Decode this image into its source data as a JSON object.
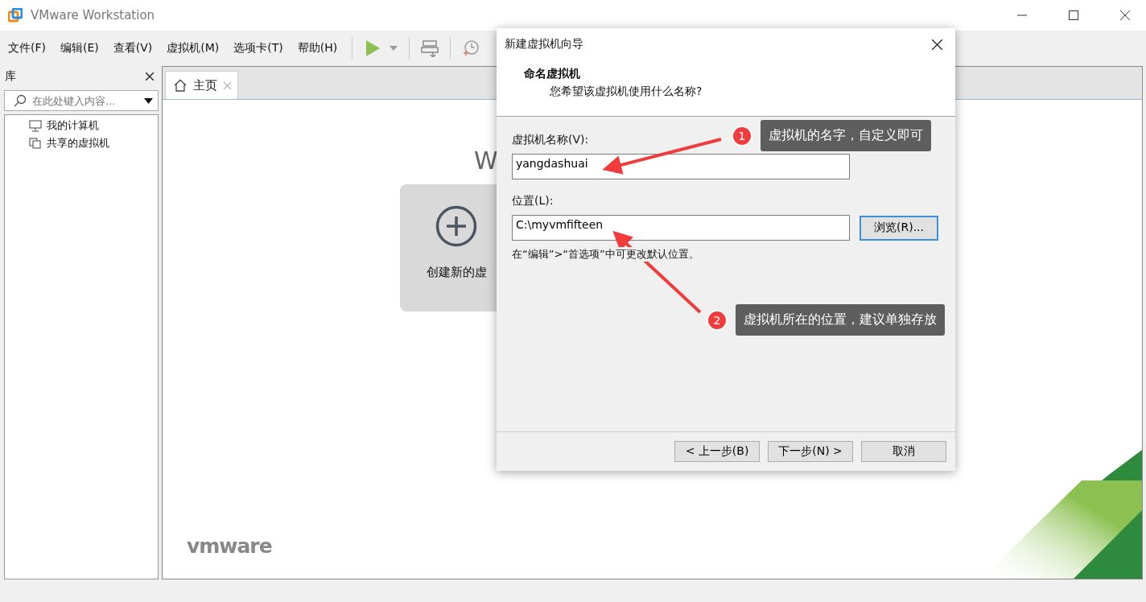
{
  "window": {
    "title": "VMware Workstation"
  },
  "menu": [
    "文件(F)",
    "编辑(E)",
    "查看(V)",
    "虚拟机(M)",
    "选项卡(T)",
    "帮助(H)"
  ],
  "library": {
    "title": "库",
    "search": {
      "placeholder": "在此处键入内容..."
    },
    "items": [
      {
        "label": "我的计算机",
        "kind": "computer"
      },
      {
        "label": "共享的虚拟机",
        "kind": "shared"
      }
    ]
  },
  "tabs": [
    {
      "label": "主页",
      "selected": true
    }
  ],
  "home": {
    "heading": "W",
    "card": "创建新的虚",
    "logo": "vmware"
  },
  "dialog": {
    "title": "新建虚拟机向导",
    "heading": "命名虚拟机",
    "subheading": "您希望该虚拟机使用什么名称?",
    "name_label": "虚拟机名称(V):",
    "name_value": "yangdashuai",
    "location_label": "位置(L):",
    "location_value": "C:\\myvmfifteen",
    "browse": "浏览(R)...",
    "hint": "在“编辑”>“首选项”中可更改默认位置。",
    "buttons": [
      "< 上一步(B)",
      "下一步(N) >",
      "取消"
    ]
  },
  "annotations": [
    {
      "number": "1",
      "text": "虚拟机的名字，自定义即可"
    },
    {
      "number": "2",
      "text": "虚拟机所在的位置，建议单独存放"
    }
  ]
}
